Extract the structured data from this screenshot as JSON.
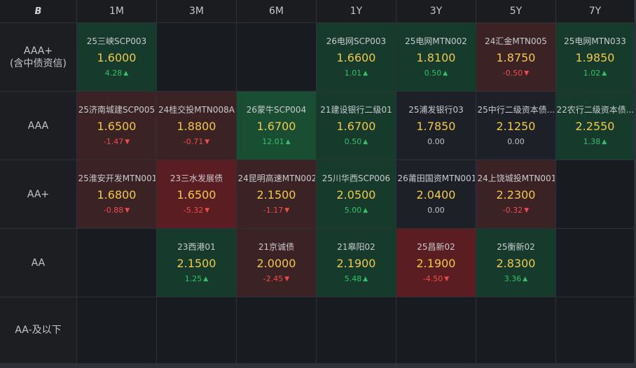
{
  "logo": "B",
  "columns": [
    "1M",
    "3M",
    "6M",
    "1Y",
    "3Y",
    "5Y",
    "7Y"
  ],
  "rows": [
    {
      "label": "AAA+",
      "sublabel": "(含中债资信)",
      "cells": [
        {
          "name": "25三峡SCP003",
          "value": "1.6000",
          "change": "4.28",
          "dir": "up",
          "tone": "g"
        },
        null,
        null,
        {
          "name": "26电网SCP003",
          "value": "1.6600",
          "change": "1.01",
          "dir": "up",
          "tone": "g"
        },
        {
          "name": "25电网MTN002",
          "value": "1.8100",
          "change": "0.50",
          "dir": "up",
          "tone": "g"
        },
        {
          "name": "24汇金MTN005",
          "value": "1.8750",
          "change": "-0.50",
          "dir": "down",
          "tone": "r"
        },
        {
          "name": "25电网MTN033",
          "value": "1.9850",
          "change": "1.02",
          "dir": "up",
          "tone": "g"
        }
      ]
    },
    {
      "label": "AAA",
      "sublabel": "",
      "cells": [
        {
          "name": "25济南城建SCP005",
          "value": "1.6500",
          "change": "-1.47",
          "dir": "down",
          "tone": "r"
        },
        {
          "name": "24桂交投MTN008A",
          "value": "1.8800",
          "change": "-0.71",
          "dir": "down",
          "tone": "r"
        },
        {
          "name": "26蒙牛SCP004",
          "value": "1.6700",
          "change": "12.01",
          "dir": "up",
          "tone": "G"
        },
        {
          "name": "21建设银行二级01",
          "value": "1.6700",
          "change": "0.50",
          "dir": "up",
          "tone": "g"
        },
        {
          "name": "25浦发银行03",
          "value": "1.7850",
          "change": "0.00",
          "dir": "flat",
          "tone": "n"
        },
        {
          "name": "25中行二级资本债...",
          "value": "2.1250",
          "change": "0.00",
          "dir": "flat",
          "tone": "n"
        },
        {
          "name": "22农行二级资本债...",
          "value": "2.2550",
          "change": "1.38",
          "dir": "up",
          "tone": "g"
        }
      ]
    },
    {
      "label": "AA+",
      "sublabel": "",
      "cells": [
        {
          "name": "25淮安开发MTN001",
          "value": "1.6800",
          "change": "-0.88",
          "dir": "down",
          "tone": "r"
        },
        {
          "name": "23三水发展债",
          "value": "1.6500",
          "change": "-5.32",
          "dir": "down",
          "tone": "R"
        },
        {
          "name": "24昆明高速MTN002",
          "value": "2.1500",
          "change": "-1.17",
          "dir": "down",
          "tone": "r"
        },
        {
          "name": "25川华西SCP006",
          "value": "2.0500",
          "change": "5.00",
          "dir": "up",
          "tone": "g"
        },
        {
          "name": "26莆田国资MTN001",
          "value": "2.0400",
          "change": "0.00",
          "dir": "flat",
          "tone": "n"
        },
        {
          "name": "24上饶城投MTN001",
          "value": "2.2300",
          "change": "-0.32",
          "dir": "down",
          "tone": "r"
        },
        null
      ]
    },
    {
      "label": "AA",
      "sublabel": "",
      "cells": [
        null,
        {
          "name": "23西港01",
          "value": "2.1500",
          "change": "1.25",
          "dir": "up",
          "tone": "g"
        },
        {
          "name": "21京诚债",
          "value": "2.0000",
          "change": "-2.45",
          "dir": "down",
          "tone": "r"
        },
        {
          "name": "21皋阳02",
          "value": "2.1900",
          "change": "5.48",
          "dir": "up",
          "tone": "g"
        },
        {
          "name": "25昌新02",
          "value": "2.1900",
          "change": "-4.50",
          "dir": "down",
          "tone": "R"
        },
        {
          "name": "25衡新02",
          "value": "2.8300",
          "change": "3.36",
          "dir": "up",
          "tone": "g"
        },
        null
      ]
    },
    {
      "label": "AA-及以下",
      "sublabel": "",
      "cells": [
        null,
        null,
        null,
        null,
        null,
        null,
        null
      ]
    }
  ]
}
